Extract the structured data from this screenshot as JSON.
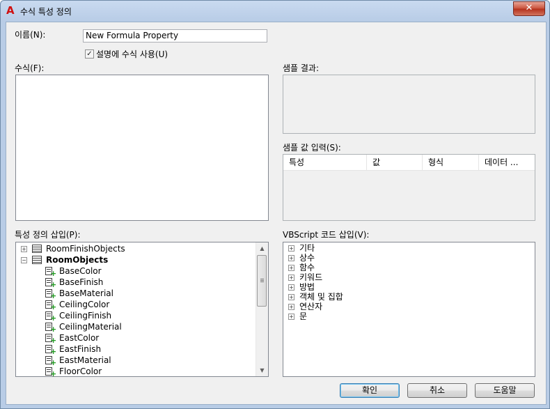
{
  "window": {
    "title": "수식 특성 정의",
    "close_label": "✕"
  },
  "form": {
    "name_label": "이름(N):",
    "name_value": "New Formula Property",
    "use_description_label": "설명에 수식 사용(U)",
    "use_description_checked": true,
    "formula_label": "수식(F):",
    "sample_result_label": "샘플 결과:",
    "sample_input_label": "샘플 값 입력(S):",
    "sample_columns": [
      "특성",
      "값",
      "형식",
      "데이터 ..."
    ]
  },
  "property_tree": {
    "label": "특성 정의 삽입(P):",
    "groups": [
      {
        "name": "RoomFinishObjects",
        "expanded": false,
        "bold": false,
        "items": []
      },
      {
        "name": "RoomObjects",
        "expanded": true,
        "bold": true,
        "items": [
          "BaseColor",
          "BaseFinish",
          "BaseMaterial",
          "CeilingColor",
          "CeilingFinish",
          "CeilingMaterial",
          "EastColor",
          "EastFinish",
          "EastMaterial",
          "FloorColor"
        ]
      }
    ]
  },
  "vbscript_tree": {
    "label": "VBScript 코드 삽입(V):",
    "items": [
      "기타",
      "상수",
      "함수",
      "키워드",
      "방법",
      "객체 및 집합",
      "연산자",
      "문"
    ]
  },
  "buttons": {
    "ok": "확인",
    "cancel": "취소",
    "help": "도움말"
  }
}
